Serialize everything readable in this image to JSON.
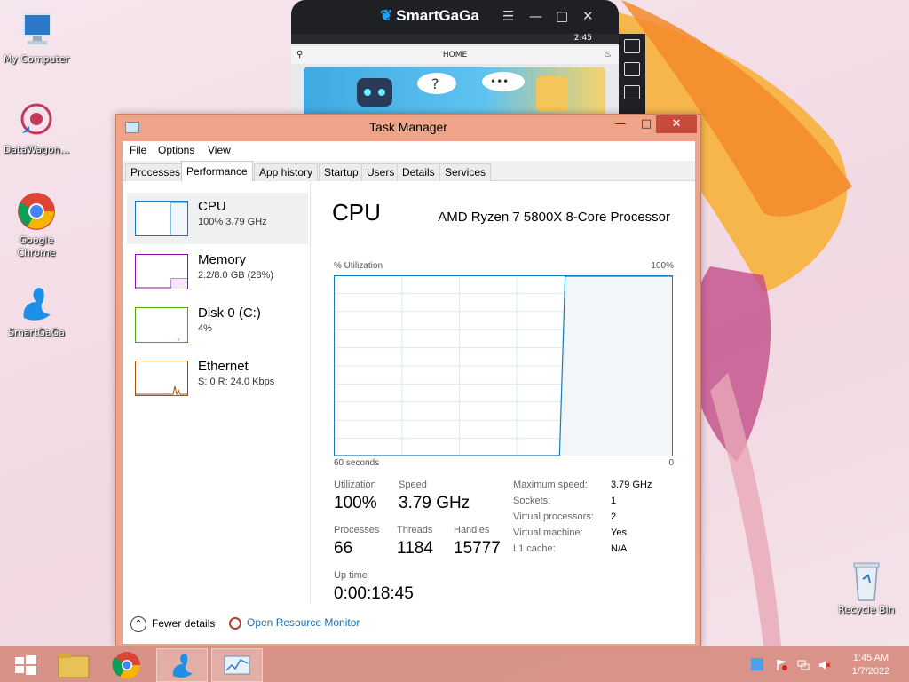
{
  "desktop": {
    "icons": [
      {
        "label": "My Computer"
      },
      {
        "label": "DataWagon..."
      },
      {
        "label": "Google Chrome"
      },
      {
        "label": "SmartGaGa"
      }
    ],
    "recycle_bin": "Recycle Bin"
  },
  "smartgaga": {
    "brand": "SmartGaGa",
    "screen_title": "HOME",
    "status_time": "2:45"
  },
  "task_manager": {
    "title": "Task Manager",
    "menus": [
      "File",
      "Options",
      "View"
    ],
    "tabs": [
      "Processes",
      "Performance",
      "App history",
      "Startup",
      "Users",
      "Details",
      "Services"
    ],
    "active_tab": "Performance",
    "resources": [
      {
        "name": "CPU",
        "value": "100%  3.79 GHz"
      },
      {
        "name": "Memory",
        "value": "2.2/8.0 GB (28%)"
      },
      {
        "name": "Disk 0 (C:)",
        "value": "4%"
      },
      {
        "name": "Ethernet",
        "value": "S: 0  R: 24.0 Kbps"
      }
    ],
    "cpu": {
      "heading": "CPU",
      "model": "AMD Ryzen 7 5800X 8-Core Processor",
      "y_label": "% Utilization",
      "y_max": "100%",
      "x_left": "60 seconds",
      "x_right": "0",
      "stats": {
        "utilization_label": "Utilization",
        "utilization": "100%",
        "speed_label": "Speed",
        "speed": "3.79 GHz",
        "processes_label": "Processes",
        "processes": "66",
        "threads_label": "Threads",
        "threads": "1184",
        "handles_label": "Handles",
        "handles": "15777",
        "uptime_label": "Up time",
        "uptime": "0:00:18:45"
      },
      "details": [
        {
          "label": "Maximum speed:",
          "value": "3.79 GHz"
        },
        {
          "label": "Sockets:",
          "value": "1"
        },
        {
          "label": "Virtual processors:",
          "value": "2"
        },
        {
          "label": "Virtual machine:",
          "value": "Yes"
        },
        {
          "label": "L1 cache:",
          "value": "N/A"
        }
      ],
      "chart_data": {
        "type": "line",
        "x_range": [
          60,
          0
        ],
        "ylim": [
          0,
          100
        ],
        "x": [
          60,
          20,
          19,
          0
        ],
        "values": [
          0,
          0,
          100,
          100
        ]
      }
    },
    "footer": {
      "fewer_details": "Fewer details",
      "resource_monitor": "Open Resource Monitor"
    }
  },
  "taskbar": {
    "time": "1:45 AM",
    "date": "1/7/2022"
  },
  "colors": {
    "accent_cpu": "#117dbb",
    "accent_memory": "#8b12ae",
    "accent_disk": "#4da60c",
    "accent_ethernet": "#a74f01",
    "window_frame": "#efa489",
    "close_button": "#c74c3c"
  }
}
